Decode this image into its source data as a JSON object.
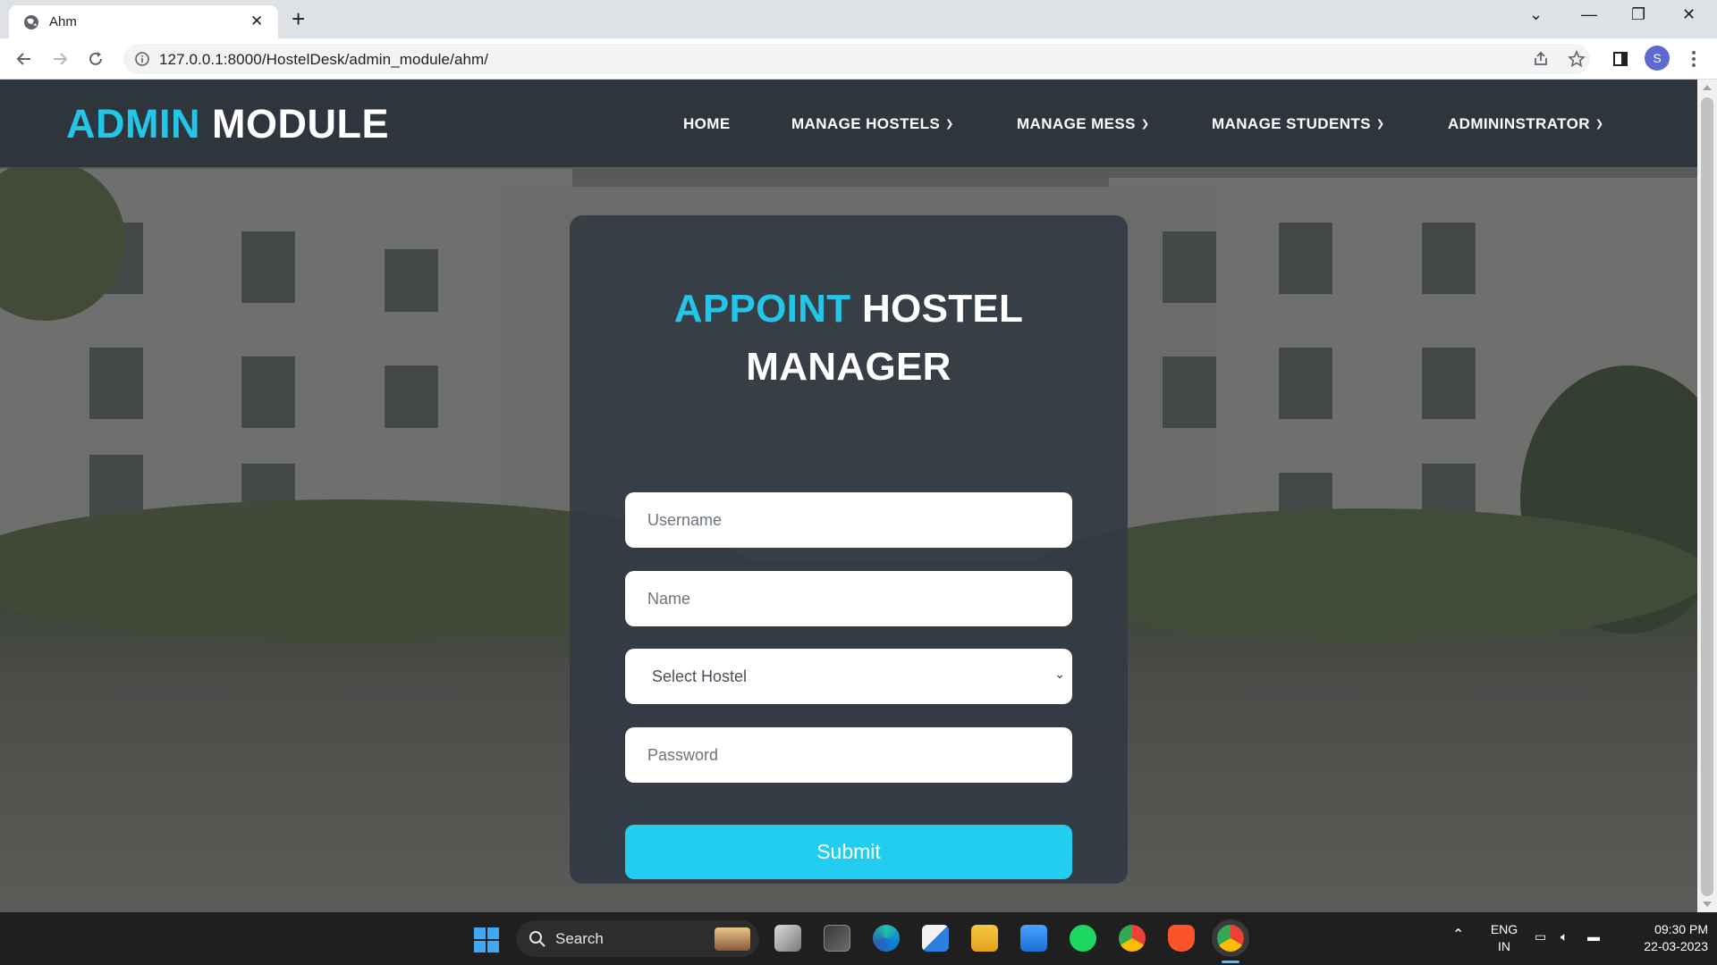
{
  "browser": {
    "tab_title": "Ahm",
    "url": "127.0.0.1:8000/HostelDesk/admin_module/ahm/",
    "profile_initial": "S"
  },
  "header": {
    "brand_accent": "ADMIN",
    "brand_rest": "MODULE",
    "nav": [
      {
        "label": "HOME",
        "dropdown": false
      },
      {
        "label": "MANAGE HOSTELS",
        "dropdown": true
      },
      {
        "label": "MANAGE MESS",
        "dropdown": true
      },
      {
        "label": "MANAGE STUDENTS",
        "dropdown": true
      },
      {
        "label": "ADMININSTRATOR",
        "dropdown": true
      }
    ]
  },
  "form": {
    "title_accent": "APPOINT",
    "title_rest": "HOSTEL",
    "title_line2": "MANAGER",
    "username_placeholder": "Username",
    "name_placeholder": "Name",
    "hostel_select": "Select Hostel",
    "password_placeholder": "Password",
    "submit_label": "Submit"
  },
  "taskbar": {
    "search_label": "Search",
    "lang_line1": "ENG",
    "lang_line2": "IN",
    "time": "09:30 PM",
    "date": "22-03-2023"
  },
  "colors": {
    "accent": "#22c6e8",
    "button": "#22cdef",
    "header_bg": "#2f353d",
    "card_bg": "#343a44"
  }
}
